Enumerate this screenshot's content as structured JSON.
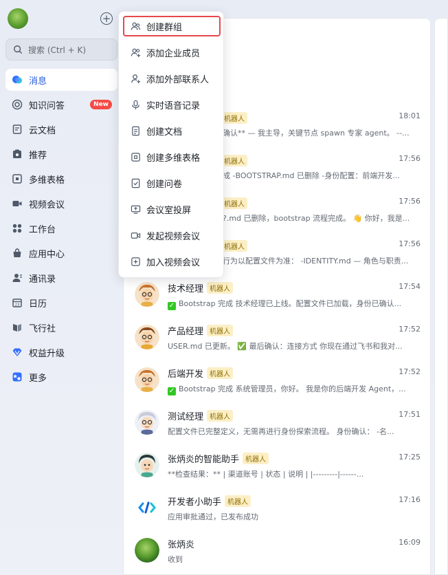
{
  "sidebar": {
    "search_placeholder": "搜索 (Ctrl + K)",
    "items": [
      {
        "label": "消息",
        "icon": "message-icon",
        "active": true
      },
      {
        "label": "知识问答",
        "icon": "knowledge-icon",
        "badge": "New"
      },
      {
        "label": "云文档",
        "icon": "cloud-doc-icon"
      },
      {
        "label": "推荐",
        "icon": "recommend-icon"
      },
      {
        "label": "多维表格",
        "icon": "bitable-icon"
      },
      {
        "label": "视频会议",
        "icon": "video-meeting-icon"
      },
      {
        "label": "工作台",
        "icon": "workplace-icon"
      },
      {
        "label": "应用中心",
        "icon": "app-center-icon"
      },
      {
        "label": "通讯录",
        "icon": "contacts-icon"
      },
      {
        "label": "日历",
        "icon": "calendar-icon"
      },
      {
        "label": "飞行社",
        "icon": "flight-club-icon"
      },
      {
        "label": "权益升级",
        "icon": "upgrade-icon"
      },
      {
        "label": "更多",
        "icon": "more-icon"
      }
    ]
  },
  "menu": {
    "items": [
      {
        "label": "创建群组",
        "icon": "create-group-icon",
        "highlighted": true
      },
      {
        "label": "添加企业成员",
        "icon": "add-member-icon"
      },
      {
        "label": "添加外部联系人",
        "icon": "add-external-contact-icon"
      },
      {
        "label": "实时语音记录",
        "icon": "microphone-icon"
      },
      {
        "label": "创建文档",
        "icon": "document-icon"
      },
      {
        "label": "创建多维表格",
        "icon": "bitable-icon"
      },
      {
        "label": "创建问卷",
        "icon": "survey-icon"
      },
      {
        "label": "会议室投屏",
        "icon": "screen-cast-icon"
      },
      {
        "label": "发起视频会议",
        "icon": "video-camera-icon"
      },
      {
        "label": "加入视频会议",
        "icon": "join-meeting-icon"
      }
    ]
  },
  "partial_chats": [
    {
      "tag": "机器人",
      "time": "18:01",
      "preview": "确认** — 我主导，关键节点 spawn 专家 agent。 --..."
    },
    {
      "tag": "机器人",
      "time": "17:56",
      "preview": "成 -BOOTSTRAP.md 已删除 -身份配置：前端开发..."
    },
    {
      "tag": "机器人",
      "time": "17:56",
      "preview": "?.md 已删除，bootstrap 流程完成。 👋 你好，我是..."
    },
    {
      "tag": "机器人",
      "time": "17:56",
      "preview": "行为以配置文件为准： -IDENTITY.md — 角色与职责..."
    }
  ],
  "chats": [
    {
      "name": "技术经理",
      "tag": "机器人",
      "time": "17:54",
      "check": true,
      "preview": "Bootstrap 完成 技术经理已上线。配置文件已加载，身份已确认..."
    },
    {
      "name": "产品经理",
      "tag": "机器人",
      "time": "17:52",
      "check": false,
      "preview": "USER.md 已更新。 ✅ 最后确认：连接方式 你现在通过飞书和我对..."
    },
    {
      "name": "后端开发",
      "tag": "机器人",
      "time": "17:52",
      "check": true,
      "preview": "Bootstrap 完成 系统管理员，你好。 我是你的后端开发 Agent，..."
    },
    {
      "name": "测试经理",
      "tag": "机器人",
      "time": "17:51",
      "check": false,
      "preview": "配置文件已完整定义，无需再进行身份探索流程。 身份确认： -名..."
    },
    {
      "name": "张炳炎的智能助手",
      "tag": "机器人",
      "time": "17:25",
      "check": false,
      "preview": "**检查结果：** | 渠道账号 | 状态 | 说明 | |---------|------..."
    },
    {
      "name": "开发者小助手",
      "tag": "机器人",
      "time": "17:16",
      "check": false,
      "preview": "应用审批通过，已发布成功"
    },
    {
      "name": "张炳炎",
      "tag": "",
      "time": "16:09",
      "check": false,
      "preview": "收到"
    }
  ],
  "colors": {
    "accent": "#245bdb",
    "badge": "#f54a45",
    "highlight_border": "#e5484d",
    "check_green": "#34c724",
    "tag_bg": "#fcefc6"
  }
}
